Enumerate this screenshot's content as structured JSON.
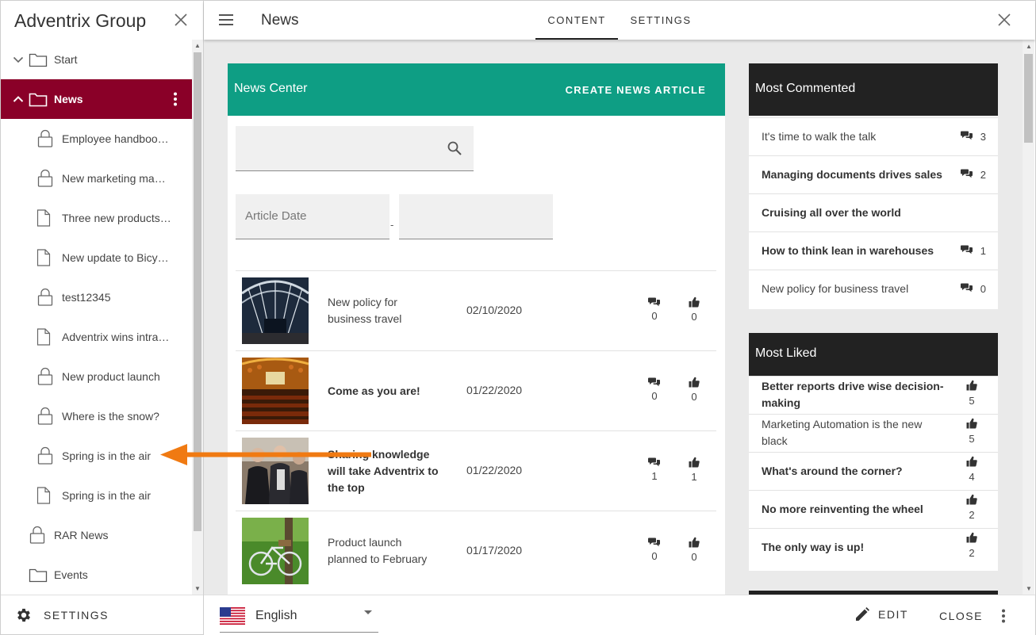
{
  "sidebar": {
    "title": "Adventrix Group",
    "tree": [
      {
        "label": "Start",
        "icon": "folder-icon",
        "expand": "chevron-down-icon",
        "indent": 0
      },
      {
        "label": "News",
        "icon": "folder-icon",
        "expand": "chevron-up-icon",
        "indent": 0,
        "selected": true
      },
      {
        "label": "Employee handboo…",
        "icon": "lock-icon",
        "indent": 1
      },
      {
        "label": "New marketing ma…",
        "icon": "lock-icon",
        "indent": 1
      },
      {
        "label": "Three new products…",
        "icon": "document-icon",
        "indent": 1
      },
      {
        "label": "New update to Bicy…",
        "icon": "document-icon",
        "indent": 1
      },
      {
        "label": "test12345",
        "icon": "lock-icon",
        "indent": 1
      },
      {
        "label": "Adventrix wins intra…",
        "icon": "document-icon",
        "indent": 1
      },
      {
        "label": "New product launch",
        "icon": "lock-icon",
        "indent": 1
      },
      {
        "label": "Where is the snow?",
        "icon": "lock-icon",
        "indent": 1
      },
      {
        "label": "Spring is in the air",
        "icon": "lock-icon",
        "indent": 1
      },
      {
        "label": "Spring is in the air",
        "icon": "document-icon",
        "indent": 1
      },
      {
        "label": "RAR News",
        "icon": "lock-icon",
        "indent": 0.5
      },
      {
        "label": "Events",
        "icon": "folder-icon",
        "indent": 0.5
      }
    ],
    "footer_label": "SETTINGS"
  },
  "topbar": {
    "title": "News",
    "tabs": [
      {
        "label": "CONTENT",
        "active": true
      },
      {
        "label": "SETTINGS",
        "active": false
      }
    ]
  },
  "news_center": {
    "title": "News Center",
    "create_label": "CREATE NEWS ARTICLE",
    "search_value": "",
    "date_from_placeholder": "Article Date",
    "date_separator": "-",
    "articles": [
      {
        "title": "New policy for business travel",
        "bold": false,
        "date": "02/10/2020",
        "comments": "0",
        "likes": "0",
        "image": "train-station-image"
      },
      {
        "title": "Come as you are!",
        "bold": true,
        "date": "01/22/2020",
        "comments": "0",
        "likes": "0",
        "image": "auditorium-image"
      },
      {
        "title": "Sharing knowledge will take Adventrix to the top",
        "bold": true,
        "date": "01/22/2020",
        "comments": "1",
        "likes": "1",
        "image": "business-people-image"
      },
      {
        "title": "Product launch planned to February",
        "bold": false,
        "date": "01/17/2020",
        "comments": "0",
        "likes": "0",
        "image": "bicycle-image"
      }
    ]
  },
  "most_commented": {
    "title": "Most Commented",
    "items": [
      {
        "title": "It's time to walk the talk",
        "bold": false,
        "count": "3"
      },
      {
        "title": "Managing documents drives sales",
        "bold": true,
        "count": "2"
      },
      {
        "title": "Cruising all over the world",
        "bold": true,
        "count": ""
      },
      {
        "title": "How to think lean in warehouses",
        "bold": true,
        "count": "1"
      },
      {
        "title": "New policy for business travel",
        "bold": false,
        "count": "0"
      }
    ]
  },
  "most_liked": {
    "title": "Most Liked",
    "items": [
      {
        "title": "Better reports drive wise decision-making",
        "bold": true,
        "count": "5"
      },
      {
        "title": "Marketing Automation is the new black",
        "bold": false,
        "count": "5"
      },
      {
        "title": "What's around the corner?",
        "bold": true,
        "count": "4"
      },
      {
        "title": "No more reinventing the wheel",
        "bold": true,
        "count": "2"
      },
      {
        "title": "The only way is up!",
        "bold": true,
        "count": "2"
      }
    ]
  },
  "bottombar": {
    "language": "English",
    "edit_label": "EDIT",
    "close_label": "CLOSE"
  },
  "colors": {
    "selected_bg": "#8a0028",
    "news_header_bg": "#0e9e84",
    "side_header_bg": "#222222",
    "annotation_arrow": "#f07a12"
  }
}
